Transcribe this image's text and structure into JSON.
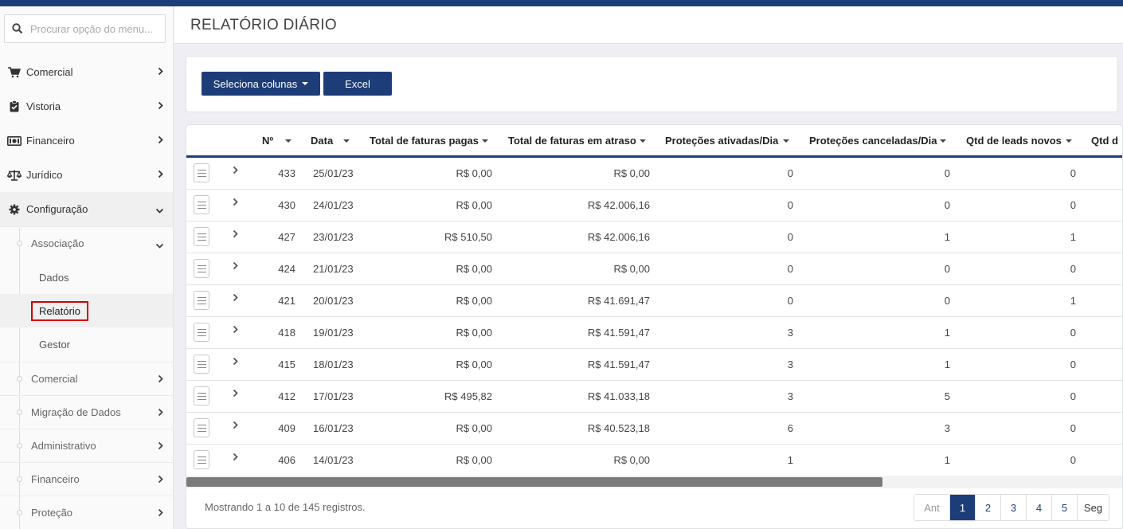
{
  "sidebar": {
    "search_placeholder": "Procurar opção do menu...",
    "menu": [
      {
        "label": "Comercial"
      },
      {
        "label": "Vistoria"
      },
      {
        "label": "Financeiro"
      },
      {
        "label": "Jurídico"
      },
      {
        "label": "Configuração"
      }
    ],
    "config_sub": {
      "associacao": "Associação",
      "dados": "Dados",
      "relatorio": "Relatório",
      "gestor": "Gestor",
      "comercial": "Comercial",
      "migracao": "Migração de Dados",
      "administrativo": "Administrativo",
      "financeiro": "Financeiro",
      "protecao": "Proteção"
    }
  },
  "header": {
    "title": "RELATÓRIO DIÁRIO"
  },
  "toolbar": {
    "columns_label": "Seleciona colunas",
    "excel_label": "Excel"
  },
  "table": {
    "columns": [
      "Nº",
      "Data",
      "Total de faturas pagas",
      "Total de faturas em atraso",
      "Proteções ativadas/Dia",
      "Proteções canceladas/Dia",
      "Qtd de leads novos",
      "Qtd d"
    ],
    "rows": [
      {
        "n": "433",
        "data": "25/01/23",
        "pagas": "R$ 0,00",
        "atraso": "R$ 0,00",
        "ativadas": "0",
        "canceladas": "0",
        "leads": "0"
      },
      {
        "n": "430",
        "data": "24/01/23",
        "pagas": "R$ 0,00",
        "atraso": "R$ 42.006,16",
        "ativadas": "0",
        "canceladas": "0",
        "leads": "0"
      },
      {
        "n": "427",
        "data": "23/01/23",
        "pagas": "R$ 510,50",
        "atraso": "R$ 42.006,16",
        "ativadas": "0",
        "canceladas": "1",
        "leads": "1"
      },
      {
        "n": "424",
        "data": "21/01/23",
        "pagas": "R$ 0,00",
        "atraso": "R$ 0,00",
        "ativadas": "0",
        "canceladas": "0",
        "leads": "0"
      },
      {
        "n": "421",
        "data": "20/01/23",
        "pagas": "R$ 0,00",
        "atraso": "R$ 41.691,47",
        "ativadas": "0",
        "canceladas": "0",
        "leads": "1"
      },
      {
        "n": "418",
        "data": "19/01/23",
        "pagas": "R$ 0,00",
        "atraso": "R$ 41.591,47",
        "ativadas": "3",
        "canceladas": "1",
        "leads": "0"
      },
      {
        "n": "415",
        "data": "18/01/23",
        "pagas": "R$ 0,00",
        "atraso": "R$ 41.591,47",
        "ativadas": "3",
        "canceladas": "1",
        "leads": "0"
      },
      {
        "n": "412",
        "data": "17/01/23",
        "pagas": "R$ 495,82",
        "atraso": "R$ 41.033,18",
        "ativadas": "3",
        "canceladas": "5",
        "leads": "0"
      },
      {
        "n": "409",
        "data": "16/01/23",
        "pagas": "R$ 0,00",
        "atraso": "R$ 40.523,18",
        "ativadas": "6",
        "canceladas": "3",
        "leads": "0"
      },
      {
        "n": "406",
        "data": "14/01/23",
        "pagas": "R$ 0,00",
        "atraso": "R$ 0,00",
        "ativadas": "1",
        "canceladas": "1",
        "leads": "0"
      }
    ],
    "info": "Mostrando 1 a 10 de 145 registros."
  },
  "pagination": {
    "prev": "Ant",
    "pages": [
      "1",
      "2",
      "3",
      "4",
      "5"
    ],
    "active": "1",
    "next": "Seg"
  },
  "colors": {
    "primary": "#1d3d78",
    "highlight": "#d40000"
  }
}
